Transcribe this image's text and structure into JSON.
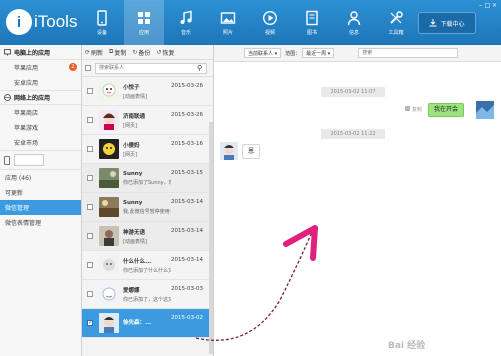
{
  "app": {
    "logo_letter": "i",
    "logo_text": "iTools"
  },
  "nav": [
    {
      "label": "设备",
      "icon": "phone-icon"
    },
    {
      "label": "应用",
      "icon": "apps-icon"
    },
    {
      "label": "音乐",
      "icon": "music-icon"
    },
    {
      "label": "照片",
      "icon": "photo-icon"
    },
    {
      "label": "视频",
      "icon": "video-icon"
    },
    {
      "label": "图书",
      "icon": "book-icon"
    },
    {
      "label": "信息",
      "icon": "user-icon"
    },
    {
      "label": "工具箱",
      "icon": "tools-icon"
    }
  ],
  "download_center": "下载中心",
  "sidebar": {
    "pc_header": "电脑上的应用",
    "pc_items": [
      {
        "label": "苹果应用",
        "badge": "2"
      },
      {
        "label": "安卓应用"
      }
    ],
    "net_header": "网络上的应用",
    "net_items": [
      {
        "label": "苹果商店"
      },
      {
        "label": "苹果游戏"
      },
      {
        "label": "安卓市场"
      }
    ],
    "device_items": [
      {
        "label": "应用 (46)"
      },
      {
        "label": "可更新"
      },
      {
        "label": "微信管理"
      },
      {
        "label": "微信表情管理"
      }
    ]
  },
  "contacts_toolbar": {
    "refresh": "刷新",
    "copy": "复制",
    "backup": "备份",
    "restore": "恢复"
  },
  "contacts_search_placeholder": "搜索联系人",
  "contacts": [
    {
      "name": "小悦子",
      "msg": "[动画表情]",
      "date": "2015-03-26"
    },
    {
      "name": "济南联通",
      "msg": "[网页]",
      "date": "2015-03-26"
    },
    {
      "name": "小傻妈",
      "msg": "[网页]",
      "date": "2015-03-16"
    },
    {
      "name": "Sunny",
      "msg": "你已添加了Sunny，现在可...",
      "date": "2015-03-15"
    },
    {
      "name": "Sunny",
      "msg": "我,此微信号暂停使用～记...",
      "date": "2015-03-14"
    },
    {
      "name": "神游无语",
      "msg": "[动画表情]",
      "date": "2015-03-14"
    },
    {
      "name": "什么什么...",
      "msg": "你已添加了什么什么又什么...",
      "date": "2015-03-14"
    },
    {
      "name": "爱娜娜",
      "msg": "你已添加了，这个这又又什么...",
      "date": "2015-03-03"
    },
    {
      "name": "徐先森：...",
      "msg": "",
      "date": "2015-03-02"
    }
  ],
  "chat_filter": {
    "contact_select": "当前联系人",
    "range_label": "范围：",
    "range_select": "最近一周",
    "search_placeholder": "搜索"
  },
  "chat": {
    "ts1": "2015-03-02 11:07",
    "out_msg": "我在开会",
    "copy_label": "复制",
    "ts2": "2015-03-02 11:22",
    "in_msg": "恩"
  },
  "watermark": "Bai 经验",
  "colors": {
    "topbar": "#1d76b9",
    "accent": "#3c9be0",
    "out_bubble": "#9be37d",
    "arrow": "#e0207c"
  }
}
